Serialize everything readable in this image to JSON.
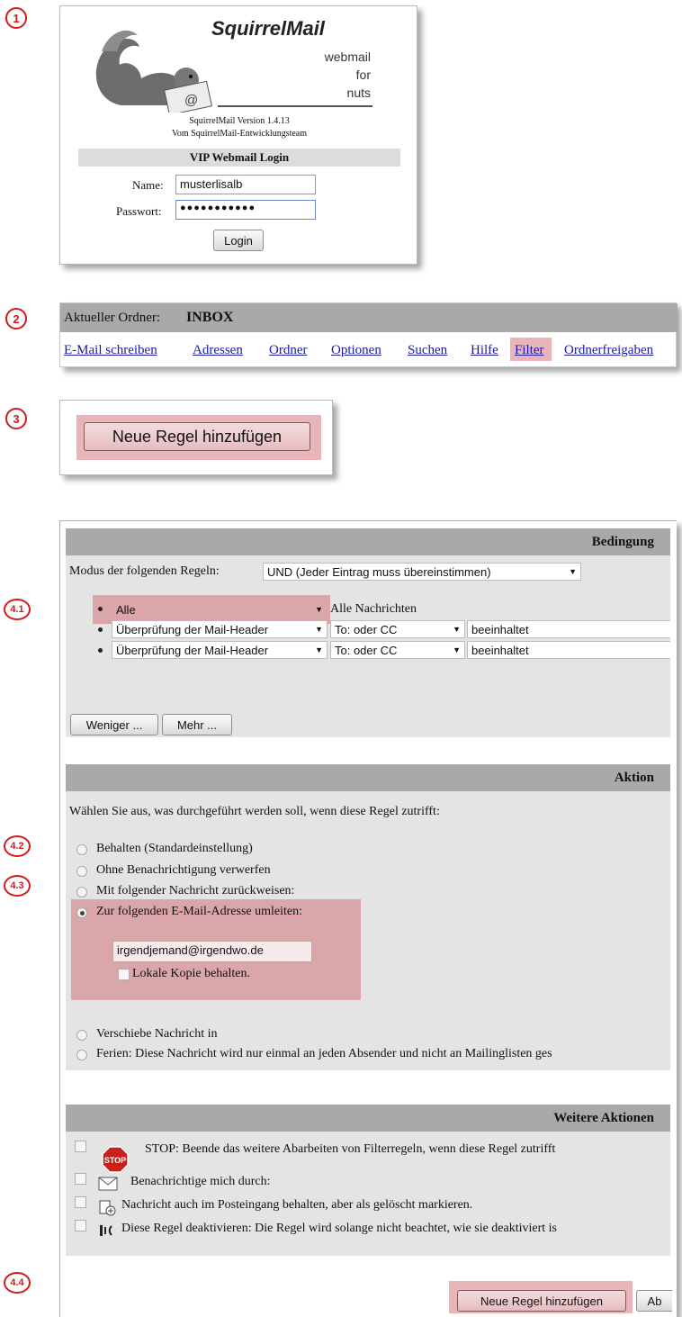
{
  "steps": [
    "1",
    "2",
    "3",
    "4.1",
    "4.2",
    "4.3",
    "4.4"
  ],
  "login": {
    "brand": "SquirrelMail",
    "tagline": [
      "webmail",
      "for",
      "nuts"
    ],
    "version": "SquirrelMail Version 1.4.13",
    "team": "Vom SquirrelMail-Entwicklungsteam",
    "title": "VIP Webmail Login",
    "name_label": "Name:",
    "name_value": "musterlisalb",
    "password_label": "Passwort:",
    "password_value": "●●●●●●●●●●●",
    "login_button": "Login"
  },
  "nav": {
    "folder_label": "Aktueller Ordner:",
    "folder_name": "INBOX",
    "links": [
      "E-Mail schreiben",
      "Adressen",
      "Ordner",
      "Optionen",
      "Suchen",
      "Hilfe",
      "Filter",
      "Ordnerfreigaben"
    ]
  },
  "step3": {
    "button": "Neue Regel hinzufügen"
  },
  "rule": {
    "condition_header": "Bedingung",
    "mode_label": "Modus der folgenden Regeln:",
    "mode_value": "UND (Jeder Eintrag muss übereinstimmen)",
    "rows": [
      {
        "type": "Alle",
        "desc": "Alle Nachrichten"
      },
      {
        "type": "Überprüfung der Mail-Header",
        "header": "To: oder CC",
        "match": "beeinhaltet"
      },
      {
        "type": "Überprüfung der Mail-Header",
        "header": "To: oder CC",
        "match": "beeinhaltet"
      }
    ],
    "less_button": "Weniger ...",
    "more_button": "Mehr ...",
    "action_header": "Aktion",
    "action_prompt": "Wählen Sie aus, was durchgeführt werden soll, wenn diese Regel zutrifft:",
    "actions": [
      "Behalten (Standardeinstellung)",
      "Ohne Benachrichtigung verwerfen",
      "Mit folgender Nachricht zurückweisen:",
      "Zur folgenden E-Mail-Adresse umleiten:"
    ],
    "redirect_address": "irgendjemand@irgendwo.de",
    "keep_copy": "Lokale Kopie behalten.",
    "actions_more": [
      "Verschiebe Nachricht in",
      "Ferien: Diese Nachricht wird nur einmal an jeden Absender und nicht an Mailinglisten ges"
    ],
    "further_header": "Weitere Aktionen",
    "stop_icon_text": "STOP",
    "further": [
      "STOP: Beende das weitere Abarbeiten von Filterregeln, wenn diese Regel zutrifft",
      "Benachrichtige mich durch:",
      "Nachricht auch im Posteingang behalten, aber als gelöscht markieren.",
      "Diese Regel deaktivieren: Die Regel wird solange nicht beachtet, wie sie deaktiviert is"
    ],
    "add_button": "Neue Regel hinzufügen",
    "cancel_button": "Ab"
  },
  "colors": {
    "accent_red": "#d21a1a",
    "highlight": "#d05a64",
    "header_gray": "#a9a9a9",
    "link_blue": "#1a1aa6"
  }
}
